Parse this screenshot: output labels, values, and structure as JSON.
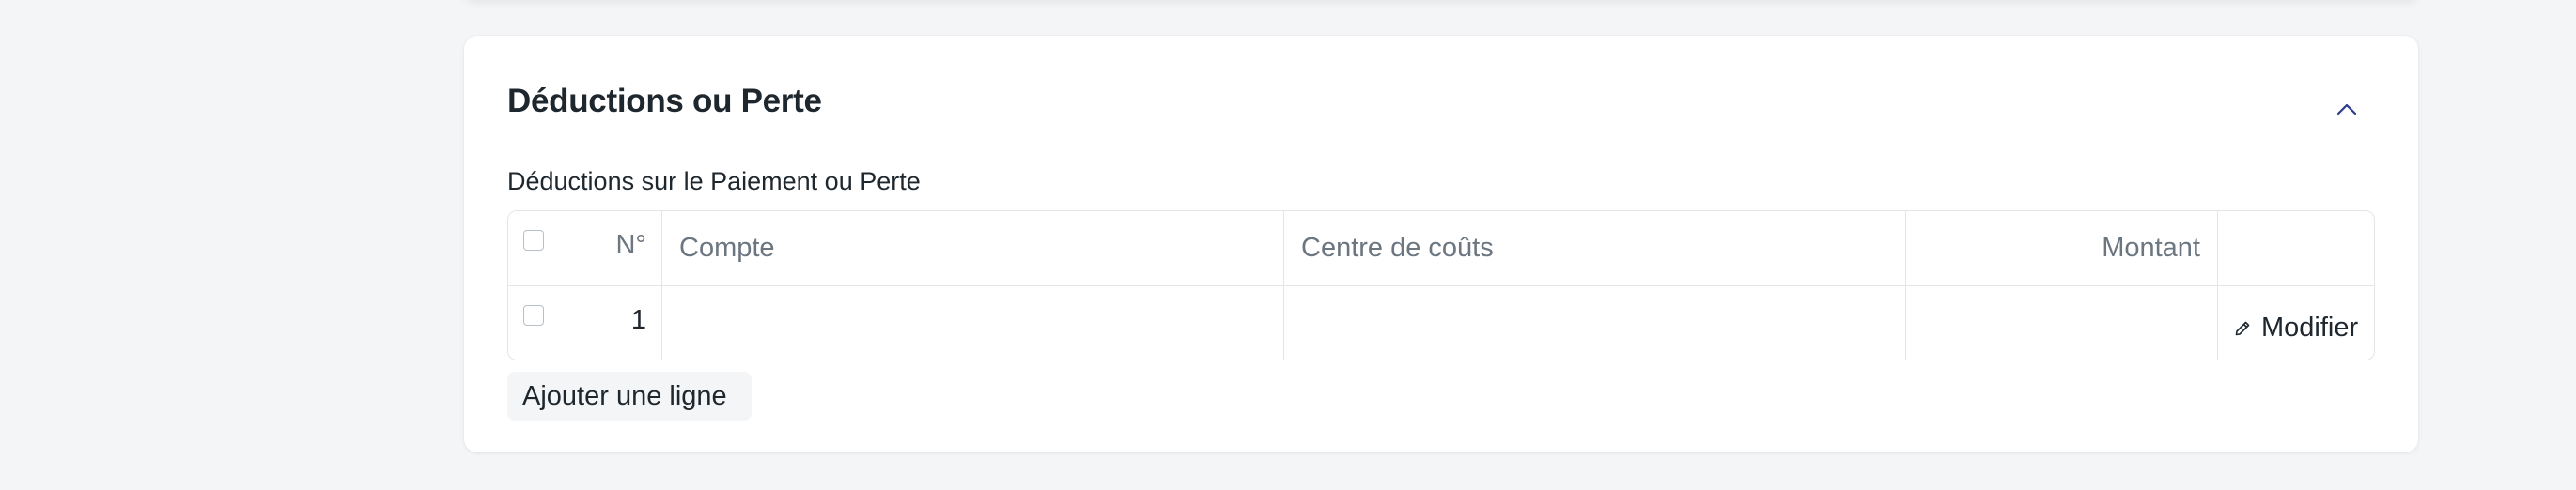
{
  "section": {
    "title": "Déductions ou Perte",
    "field_label": "Déductions sur le Paiement ou Perte"
  },
  "table": {
    "columns": {
      "index": "N°",
      "compte": "Compte",
      "centre": "Centre de coûts",
      "montant": "Montant"
    },
    "rows": [
      {
        "index": "1",
        "compte": "",
        "centre": "",
        "montant": "",
        "action": "Modifier"
      }
    ]
  },
  "buttons": {
    "add_row": "Ajouter une ligne"
  },
  "icons": {
    "collapse": "chevron-up-icon",
    "edit": "pencil-icon"
  },
  "colors": {
    "page_bg": "#f4f5f7",
    "card_bg": "#ffffff",
    "border": "#e2e6e9",
    "text": "#1f272e",
    "muted": "#6c7680",
    "accent": "#2e3a8c"
  }
}
